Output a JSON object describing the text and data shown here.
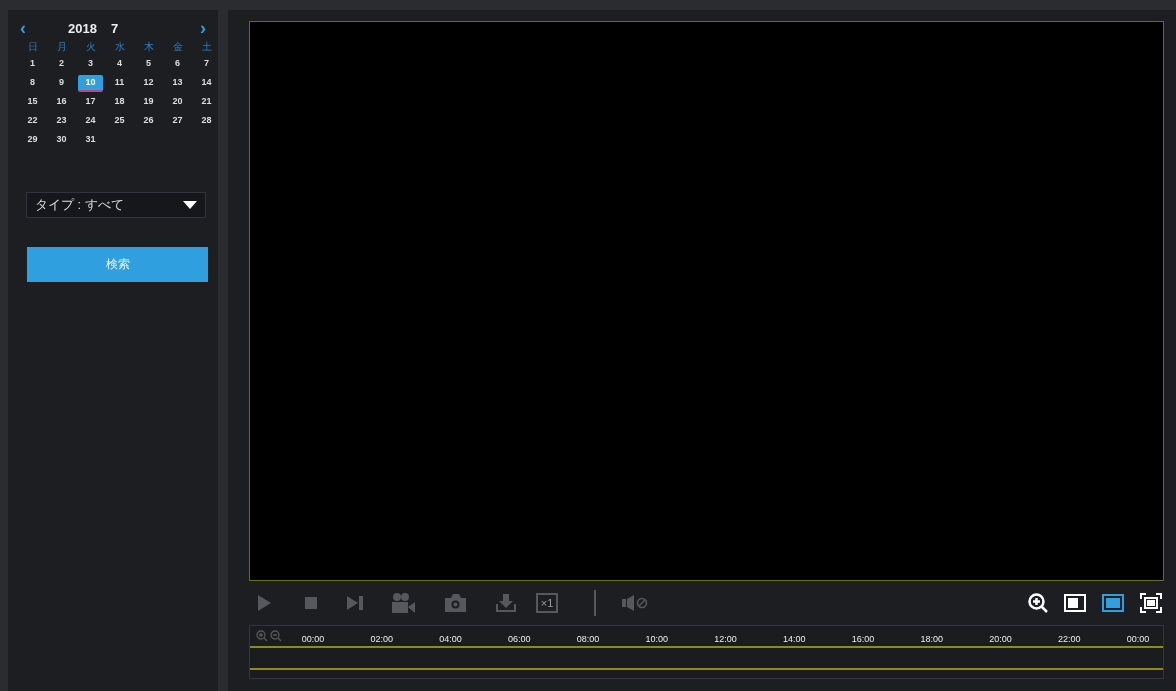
{
  "calendar": {
    "year": "2018",
    "month": "7",
    "prev": "‹",
    "next": "›",
    "weekdays": [
      "日",
      "月",
      "火",
      "水",
      "木",
      "金",
      "土"
    ],
    "days": [
      {
        "label": "1",
        "selected": false
      },
      {
        "label": "2",
        "selected": false
      },
      {
        "label": "3",
        "selected": false
      },
      {
        "label": "4",
        "selected": false
      },
      {
        "label": "5",
        "selected": false
      },
      {
        "label": "6",
        "selected": false
      },
      {
        "label": "7",
        "selected": false
      },
      {
        "label": "8",
        "selected": false
      },
      {
        "label": "9",
        "selected": false
      },
      {
        "label": "10",
        "selected": true
      },
      {
        "label": "11",
        "selected": false
      },
      {
        "label": "12",
        "selected": false
      },
      {
        "label": "13",
        "selected": false
      },
      {
        "label": "14",
        "selected": false
      },
      {
        "label": "15",
        "selected": false
      },
      {
        "label": "16",
        "selected": false
      },
      {
        "label": "17",
        "selected": false
      },
      {
        "label": "18",
        "selected": false
      },
      {
        "label": "19",
        "selected": false
      },
      {
        "label": "20",
        "selected": false
      },
      {
        "label": "21",
        "selected": false
      },
      {
        "label": "22",
        "selected": false
      },
      {
        "label": "23",
        "selected": false
      },
      {
        "label": "24",
        "selected": false
      },
      {
        "label": "25",
        "selected": false
      },
      {
        "label": "26",
        "selected": false
      },
      {
        "label": "27",
        "selected": false
      },
      {
        "label": "28",
        "selected": false
      },
      {
        "label": "29",
        "selected": false
      },
      {
        "label": "30",
        "selected": false
      },
      {
        "label": "31",
        "selected": false
      }
    ]
  },
  "type_select": {
    "value": "タイプ : すべて"
  },
  "search_button": "検索",
  "playback_controls": [
    {
      "kind": "play",
      "disabled": true
    },
    {
      "kind": "stop",
      "disabled": true
    },
    {
      "kind": "step",
      "disabled": true
    },
    {
      "kind": "record",
      "disabled": true
    },
    {
      "kind": "snapshot",
      "disabled": true
    },
    {
      "kind": "download",
      "disabled": true
    },
    {
      "kind": "speed",
      "label": "×1",
      "disabled": true
    },
    {
      "kind": "separator"
    },
    {
      "kind": "mute",
      "disabled": true
    }
  ],
  "view_controls": [
    {
      "kind": "zoom",
      "selected": false
    },
    {
      "kind": "single",
      "selected": false
    },
    {
      "kind": "fit",
      "selected": true
    },
    {
      "kind": "fullscreen",
      "selected": false
    }
  ],
  "timeline": {
    "ticks": [
      "00:00",
      "02:00",
      "04:00",
      "06:00",
      "08:00",
      "10:00",
      "12:00",
      "14:00",
      "16:00",
      "18:00",
      "20:00",
      "22:00",
      "00:00"
    ]
  }
}
